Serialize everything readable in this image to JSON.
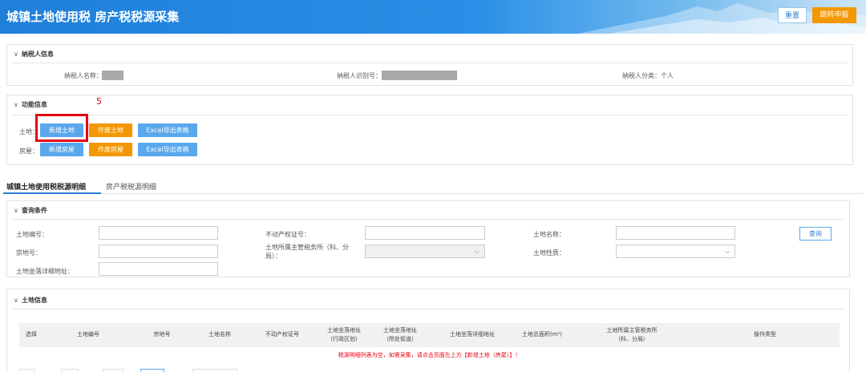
{
  "header": {
    "title": "城镇土地使用税 房产税税源采集",
    "reset_label": "重置",
    "jump_label": "跳转申报"
  },
  "taxpayer": {
    "section_title": "纳税人信息",
    "name_label": "纳税人名称：",
    "id_label": "纳税人识别号：",
    "category_label": "纳税人分类：个人"
  },
  "function": {
    "section_title": "功能信息",
    "annotation": "5",
    "land_label": "土地：",
    "house_label": "房屋：",
    "add_land": "新增土地",
    "void_land": "作废土地",
    "export_land": "Excel导出表格",
    "add_house": "新增房屋",
    "void_house": "作废房屋",
    "export_house": "Excel导出表格"
  },
  "tabs": [
    {
      "label": "城镇土地使用税税源明细"
    },
    {
      "label": "房产税税源明细"
    }
  ],
  "query": {
    "section_title": "查询条件",
    "land_no_label": "土地编号：",
    "cert_label": "不动产权证号：",
    "land_name_label": "土地名称：",
    "lot_no_label": "宗地号：",
    "office_label": "土地所属主管税务所（科、分局）：",
    "nature_label": "土地性质：",
    "address_label": "土地坐落详细地址：",
    "search_label": "查询"
  },
  "land_info": {
    "section_title": "土地信息",
    "columns": [
      "选择",
      "土地编号",
      "宗地号",
      "土地名称",
      "不动产权证号",
      "土地坐落地址\n（行政区划）",
      "土地坐落地址\n（所处街道）",
      "土地坐落详细地址",
      "土地总面积(m²)",
      "土地所属主管税务所\n（科、分局）",
      "操作类型"
    ],
    "empty_message": "税源明细列表为空，如需采集，请点击页面左上方【新增土地（房屋）】！"
  },
  "colors": {
    "header_blue": "#1f7fd9",
    "accent_orange": "#f39800",
    "button_blue": "#5aa8ec",
    "annotation_red": "#e60012"
  }
}
